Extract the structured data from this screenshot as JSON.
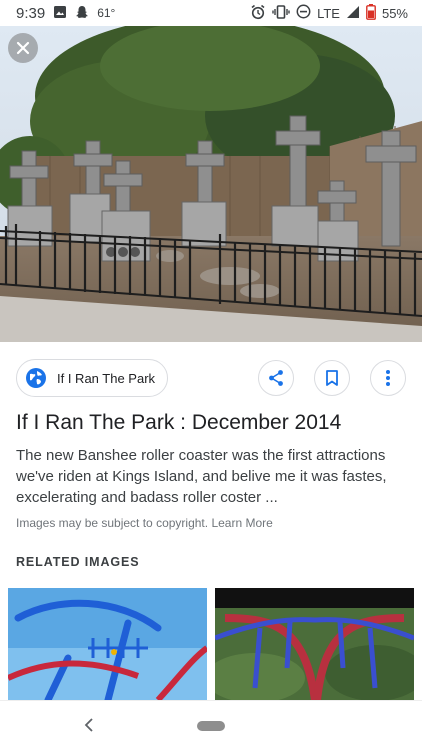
{
  "status_bar": {
    "time": "9:39",
    "temperature": "61°",
    "network": "LTE",
    "battery": "55%"
  },
  "source": {
    "name": "If I Ran The Park"
  },
  "result": {
    "title": "If I Ran The Park : December 2014",
    "description": "The new Banshee roller coaster was the first attractions we've riden at Kings Island, and belive me it was fastes, excelerating and badass roller coster ...",
    "copyright_text": "Images may be subject to copyright.",
    "learn_more": "Learn More"
  },
  "related": {
    "heading": "RELATED IMAGES"
  },
  "colors": {
    "accent_blue": "#1a73e8",
    "text_primary": "#202124",
    "text_secondary": "#70757a"
  }
}
